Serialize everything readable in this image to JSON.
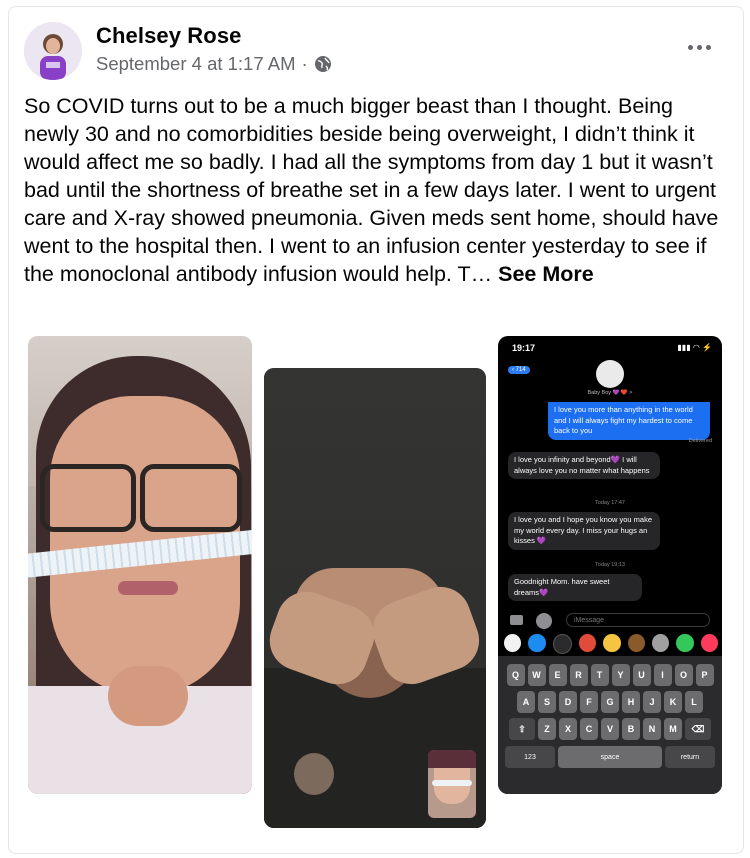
{
  "post": {
    "author": "Chelsey Rose",
    "timestamp": "September 4 at 1:17 AM",
    "separator": "·",
    "text": "So COVID turns out to be a much bigger beast than I thought. Being newly 30 and no comorbidities beside being overweight, I didn’t think it would affect me so badly. I had all the symptoms from day 1 but it wasn’t bad until the shortness of breathe set in a few days later. I went to urgent care and X-ray showed pneumonia. Given meds sent home, should have went to the hospital then. I went to an infusion center yesterday to see if the monoclonal antibody infusion would help. T…",
    "see_more": "See More",
    "icons": {
      "privacy": "globe-icon",
      "menu": "more-options-icon"
    }
  },
  "photos": {
    "screenshot": {
      "time": "19:17",
      "status": "▮▮▮ ◠ ⚡",
      "back_count": "714",
      "contact_name": "Baby Boy 💜 ❤️ >",
      "sent_message": "I love you more than anything in the world and I will always fight my hardest to come back to you",
      "delivered": "Delivered",
      "message_1": "I love you infinity and beyond💜 I will always love you no matter what happens",
      "stamp_1": "Today 17:47",
      "message_2": "I love you and I hope you know you make my world every day. I miss your hugs an kisses 💜",
      "stamp_2": "Today 19:13",
      "message_3": "Goodnight Mom. have sweet dreams💜",
      "compose_placeholder": "iMessage",
      "keyboard": {
        "row1": [
          "Q",
          "W",
          "E",
          "R",
          "T",
          "Y",
          "U",
          "I",
          "O",
          "P"
        ],
        "row2": [
          "A",
          "S",
          "D",
          "F",
          "G",
          "H",
          "J",
          "K",
          "L"
        ],
        "row3": [
          "⇧",
          "Z",
          "X",
          "C",
          "V",
          "B",
          "N",
          "M",
          "⌫"
        ],
        "numbers": "123",
        "space": "space",
        "return": "return"
      }
    }
  },
  "colors": {
    "name": "#050505",
    "meta": "#65676b",
    "imessage_blue": "#1d6ff2"
  }
}
